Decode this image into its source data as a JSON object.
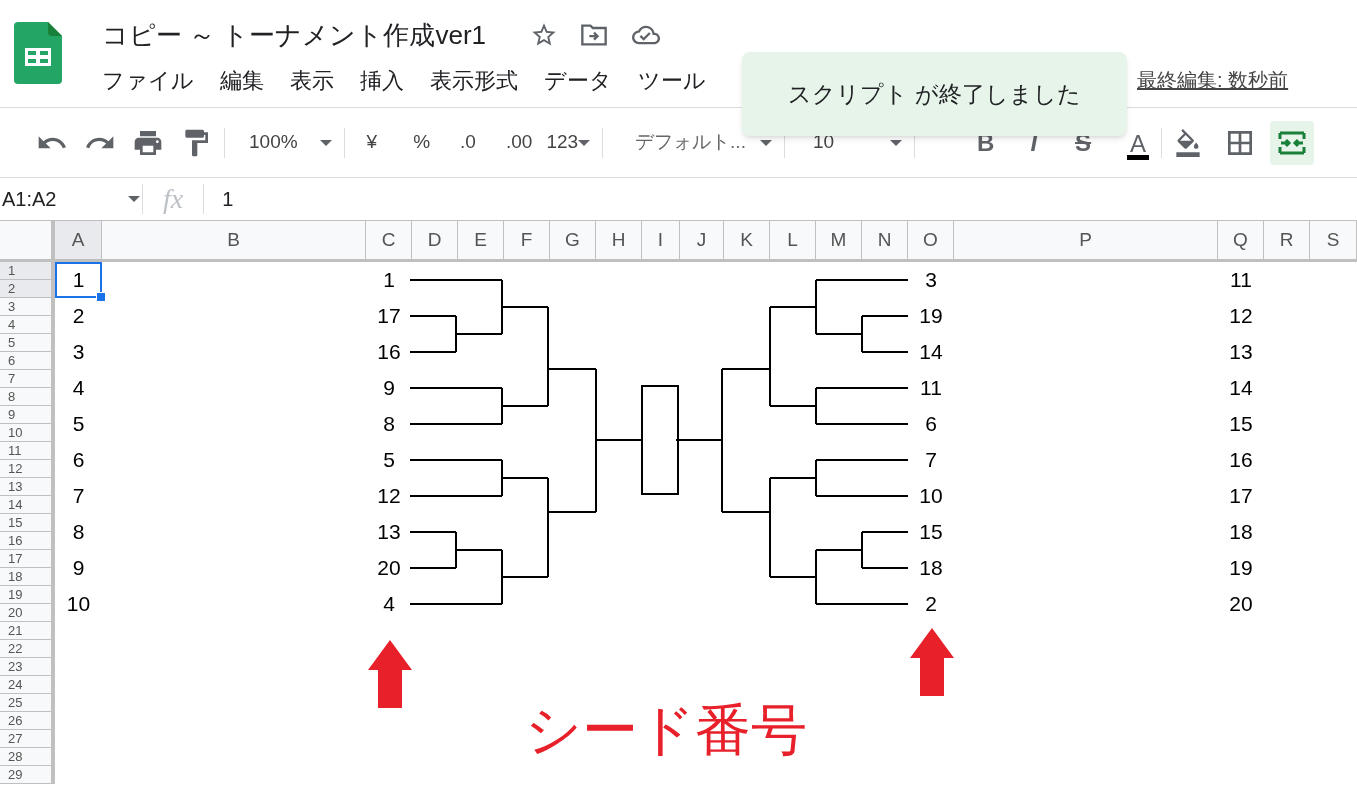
{
  "document": {
    "title": "コピー ～ トーナメント作成ver1"
  },
  "menu": [
    "ファイル",
    "編集",
    "表示",
    "挿入",
    "表示形式",
    "データ",
    "ツール"
  ],
  "last_edit": "最終編集: 数秒前",
  "toast": {
    "text": "スクリプト が終了しました"
  },
  "toolbar": {
    "zoom": "100%",
    "currency": "¥",
    "percent": "%",
    "decrease_decimals": ".0",
    "increase_decimals": ".00",
    "number_format": "123",
    "font": "デフォルト...",
    "font_size": "10",
    "bold": "B",
    "italic": "I",
    "strikethrough": "S",
    "text_color": "A",
    "merge_selected": true
  },
  "formula_bar": {
    "name_box": "A1:A2",
    "fx": "fx",
    "value": "1"
  },
  "columns": [
    {
      "label": "A",
      "selected": true,
      "cells": [
        "1",
        "2",
        "3",
        "4",
        "5",
        "6",
        "7",
        "8",
        "9",
        "10"
      ]
    },
    {
      "label": "B",
      "selected": false
    },
    {
      "label": "C",
      "selected": false,
      "cells": [
        "1",
        "17",
        "16",
        "9",
        "8",
        "5",
        "12",
        "13",
        "20",
        "4"
      ]
    },
    {
      "label": "D",
      "selected": false
    },
    {
      "label": "E",
      "selected": false
    },
    {
      "label": "F",
      "selected": false
    },
    {
      "label": "G",
      "selected": false
    },
    {
      "label": "H",
      "selected": false
    },
    {
      "label": "I",
      "selected": false
    },
    {
      "label": "J",
      "selected": false
    },
    {
      "label": "K",
      "selected": false
    },
    {
      "label": "L",
      "selected": false
    },
    {
      "label": "M",
      "selected": false
    },
    {
      "label": "N",
      "selected": false
    },
    {
      "label": "O",
      "selected": false,
      "cells": [
        "3",
        "19",
        "14",
        "11",
        "6",
        "7",
        "10",
        "15",
        "18",
        "2"
      ]
    },
    {
      "label": "P",
      "selected": false
    },
    {
      "label": "Q",
      "selected": false,
      "cells": [
        "11",
        "12",
        "13",
        "14",
        "15",
        "16",
        "17",
        "18",
        "19",
        "20"
      ]
    },
    {
      "label": "R",
      "selected": false
    },
    {
      "label": "S",
      "selected": false
    }
  ],
  "rows": [
    {
      "label": "1",
      "selected": true
    },
    {
      "label": "2",
      "selected": true
    },
    {
      "label": "3",
      "selected": false
    },
    {
      "label": "4",
      "selected": false
    },
    {
      "label": "5",
      "selected": false
    },
    {
      "label": "6",
      "selected": false
    },
    {
      "label": "7",
      "selected": false
    },
    {
      "label": "8",
      "selected": false
    },
    {
      "label": "9",
      "selected": false
    },
    {
      "label": "10",
      "selected": false
    },
    {
      "label": "11",
      "selected": false
    },
    {
      "label": "12",
      "selected": false
    },
    {
      "label": "13",
      "selected": false
    },
    {
      "label": "14",
      "selected": false
    },
    {
      "label": "15",
      "selected": false
    },
    {
      "label": "16",
      "selected": false
    },
    {
      "label": "17",
      "selected": false
    },
    {
      "label": "18",
      "selected": false
    },
    {
      "label": "19",
      "selected": false
    },
    {
      "label": "20",
      "selected": false
    },
    {
      "label": "21",
      "selected": false
    },
    {
      "label": "22",
      "selected": false
    },
    {
      "label": "23",
      "selected": false
    },
    {
      "label": "24",
      "selected": false
    },
    {
      "label": "25",
      "selected": false
    },
    {
      "label": "26",
      "selected": false
    },
    {
      "label": "27",
      "selected": false
    },
    {
      "label": "28",
      "selected": false
    },
    {
      "label": "29",
      "selected": false
    }
  ],
  "annotation": "シード番号"
}
